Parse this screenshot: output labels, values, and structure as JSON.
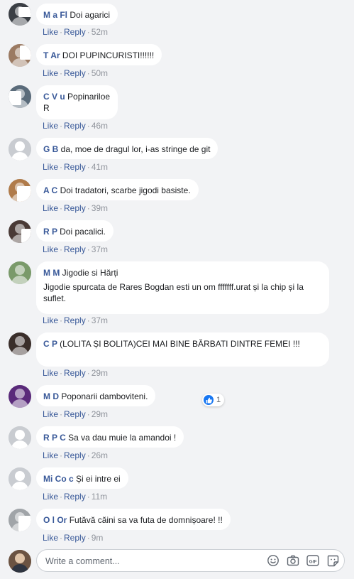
{
  "actions": {
    "like": "Like",
    "reply": "Reply",
    "separator": "·"
  },
  "comments": [
    {
      "name": "M    a Fl   ",
      "text": "Doi agarici",
      "time": "52m"
    },
    {
      "name": "T    Ar  ",
      "text": "DOI PUPINCURISTI!!!!!!",
      "time": "50m"
    },
    {
      "name": "C        V     u",
      "text": "Popinariloe",
      "text2": "R",
      "time": "46m"
    },
    {
      "name": "G    B     ",
      "text": "da, moe de dragul lor, i-as stringe de git",
      "time": "41m"
    },
    {
      "name": "A    C    ",
      "text": "Doi tradatori, scarbe jigodi basiste.",
      "time": "39m"
    },
    {
      "name": "R     P     ",
      "text": "Doi pacalici.",
      "time": "37m"
    },
    {
      "name": "M    M     ",
      "text": "Jigodie si Hărți",
      "text2": "Jigodie spurcata de Rares Bogdan esti un om fffffff.urat și la chip și la suflet.",
      "time": "37m"
    },
    {
      "name": "C        P     ",
      "text": "(LOLITA ȘI BOLITA)CEI MAI BINE BĂRBATI DINTRE FEMEI !!!",
      "time": "29m"
    },
    {
      "name": "M    D    ",
      "text": "Poponarii damboviteni.",
      "time": "29m",
      "reactions": "1"
    },
    {
      "name": "R     P  C   ",
      "text": "Sa va dau muie la amandoi !",
      "time": "26m"
    },
    {
      "name": "Mi    Co     c",
      "text": "Și ei intre ei",
      "time": "11m"
    },
    {
      "name": "O    l Or    ",
      "text": "Futăvă căini sa va futa de domnișoare! !!",
      "time": "9m"
    }
  ],
  "composer": {
    "placeholder": "Write a comment...",
    "icons": [
      "emoji-icon",
      "camera-icon",
      "gif-icon",
      "sticker-icon"
    ]
  },
  "colors": {
    "link": "#385898",
    "background": "#f2f3f5",
    "bubble": "#ffffff",
    "like_badge": "#1877f2"
  }
}
